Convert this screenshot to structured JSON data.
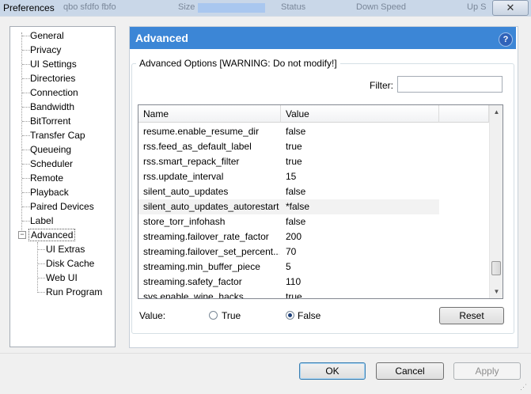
{
  "window": {
    "title": "Preferences",
    "close_glyph": "✕"
  },
  "background_columns": [
    "Size",
    "Status",
    "Down Speed",
    "Up S"
  ],
  "background_fragment": "qbo sfdfo fbfo",
  "tree": {
    "items": [
      "General",
      "Privacy",
      "UI Settings",
      "Directories",
      "Connection",
      "Bandwidth",
      "BitTorrent",
      "Transfer Cap",
      "Queueing",
      "Scheduler",
      "Remote",
      "Playback",
      "Paired Devices",
      "Label",
      "Advanced"
    ],
    "expander": "−",
    "children": [
      "UI Extras",
      "Disk Cache",
      "Web UI",
      "Run Program"
    ]
  },
  "header": {
    "title": "Advanced",
    "help_glyph": "?"
  },
  "group": {
    "legend": "Advanced Options [WARNING: Do not modify!]"
  },
  "filter": {
    "label": "Filter:",
    "value": ""
  },
  "list": {
    "columns": [
      "Name",
      "Value"
    ],
    "rows": [
      {
        "name": "resume.enable_resume_dir",
        "value": "false"
      },
      {
        "name": "rss.feed_as_default_label",
        "value": "true"
      },
      {
        "name": "rss.smart_repack_filter",
        "value": "true"
      },
      {
        "name": "rss.update_interval",
        "value": "15"
      },
      {
        "name": "silent_auto_updates",
        "value": "false"
      },
      {
        "name": "silent_auto_updates_autorestart",
        "value": "*false"
      },
      {
        "name": "store_torr_infohash",
        "value": "false"
      },
      {
        "name": "streaming.failover_rate_factor",
        "value": "200"
      },
      {
        "name": "streaming.failover_set_percent...",
        "value": "70"
      },
      {
        "name": "streaming.min_buffer_piece",
        "value": "5"
      },
      {
        "name": "streaming.safety_factor",
        "value": "110"
      },
      {
        "name": "sys.enable_wine_hacks",
        "value": "true"
      }
    ],
    "highlighted_row": "silent_auto_updates_autorestart",
    "scroll_up_glyph": "▲",
    "scroll_down_glyph": "▼"
  },
  "value_editor": {
    "label": "Value:",
    "true_label": "True",
    "false_label": "False",
    "selected": "False",
    "reset_label": "Reset"
  },
  "buttons": {
    "ok": "OK",
    "cancel": "Cancel",
    "apply": "Apply"
  },
  "grip_glyph": "⋰",
  "colors": {
    "header_bg": "#3c86d6",
    "header_text": "#ffffff",
    "help_icon": "#2f62b9"
  }
}
